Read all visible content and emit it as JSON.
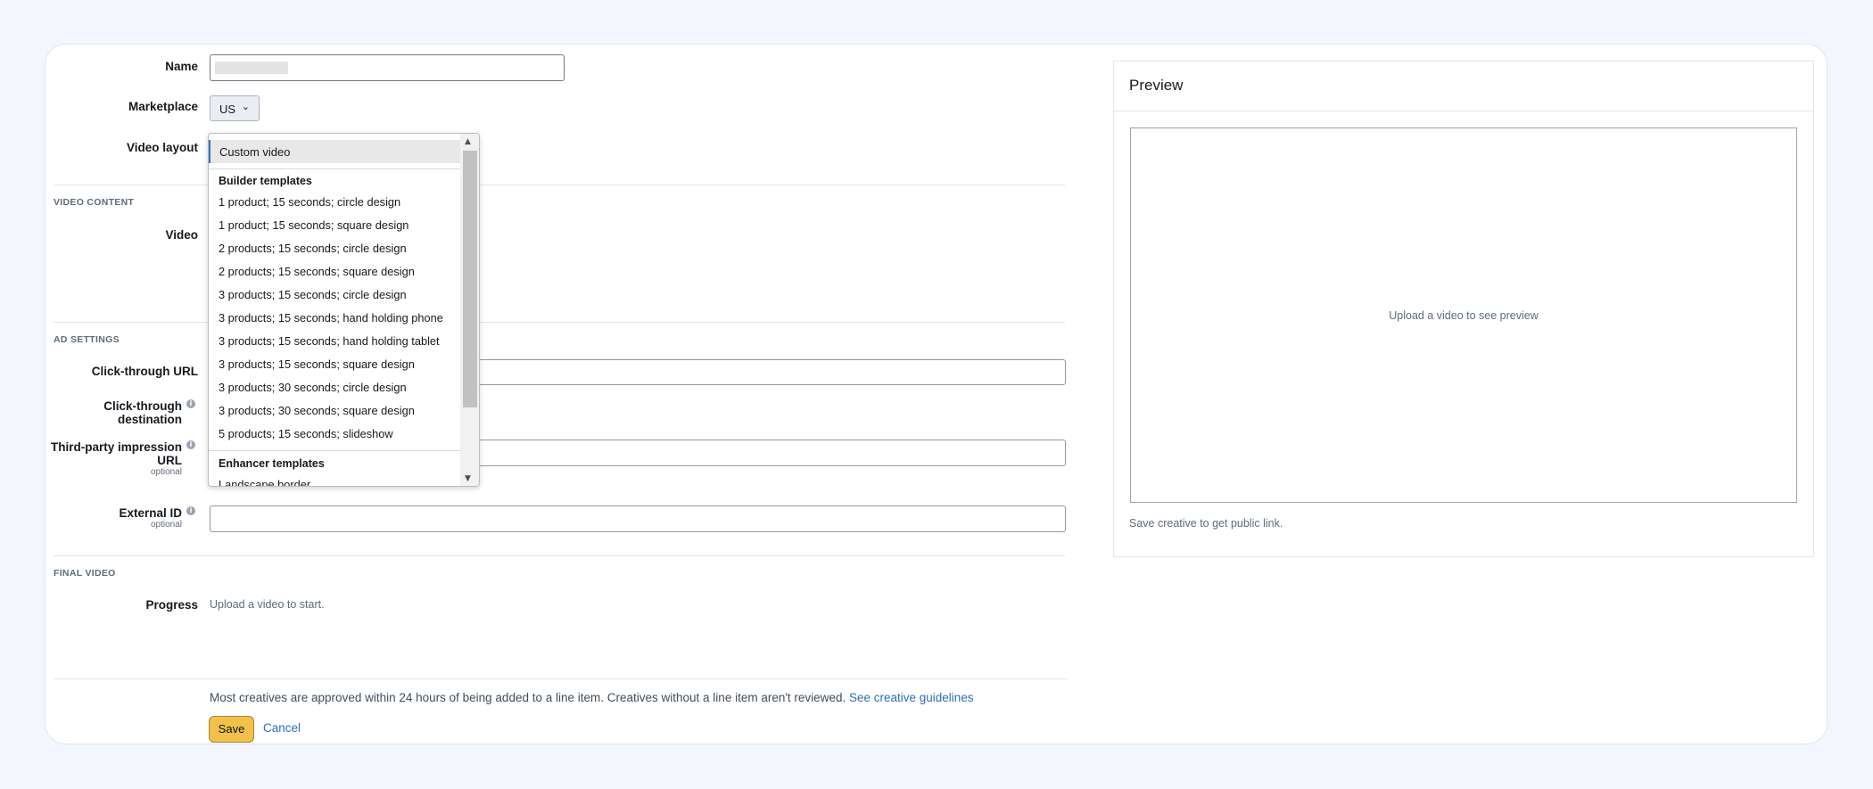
{
  "form": {
    "name_label": "Name",
    "marketplace_label": "Marketplace",
    "marketplace_value": "US",
    "video_layout_label": "Video layout",
    "sections": {
      "video_content": "VIDEO CONTENT",
      "ad_settings": "AD SETTINGS",
      "final_video": "FINAL VIDEO"
    },
    "video_label": "Video",
    "click_through_url_label": "Click-through URL",
    "click_through_destination_label": [
      "Click-through",
      "destination"
    ],
    "third_party_label": [
      "Third-party impression",
      "URL"
    ],
    "optional": "optional",
    "external_id_label": "External ID",
    "progress_label": "Progress",
    "progress_text": "Upload a video to start."
  },
  "dropdown": {
    "selected": "Custom video",
    "groups": [
      {
        "heading": "Builder templates",
        "items": [
          "1 product; 15 seconds; circle design",
          "1 product; 15 seconds; square design",
          "2 products; 15 seconds; circle design",
          "2 products; 15 seconds; square design",
          "3 products; 15 seconds; circle design",
          "3 products; 15 seconds; hand holding phone",
          "3 products; 15 seconds; hand holding tablet",
          "3 products; 15 seconds; square design",
          "3 products; 30 seconds; circle design",
          "3 products; 30 seconds; square design",
          "5 products; 15 seconds; slideshow"
        ]
      },
      {
        "heading": "Enhancer templates",
        "items": [
          "Landscape border"
        ]
      }
    ]
  },
  "preview": {
    "title": "Preview",
    "placeholder": "Upload a video to see preview",
    "note": "Save creative to get public link."
  },
  "footer": {
    "approval_text": "Most creatives are approved within 24 hours of being added to a line item. Creatives without a line item aren't reviewed.",
    "guidelines_link": "See creative guidelines",
    "save": "Save",
    "cancel": "Cancel"
  },
  "icons": {
    "info": "info-icon",
    "chevron": "chevron-down-icon"
  },
  "colors": {
    "page_bg": "#f3f6fd",
    "link": "#2d6eb5",
    "save_button": "#f0c14b"
  }
}
